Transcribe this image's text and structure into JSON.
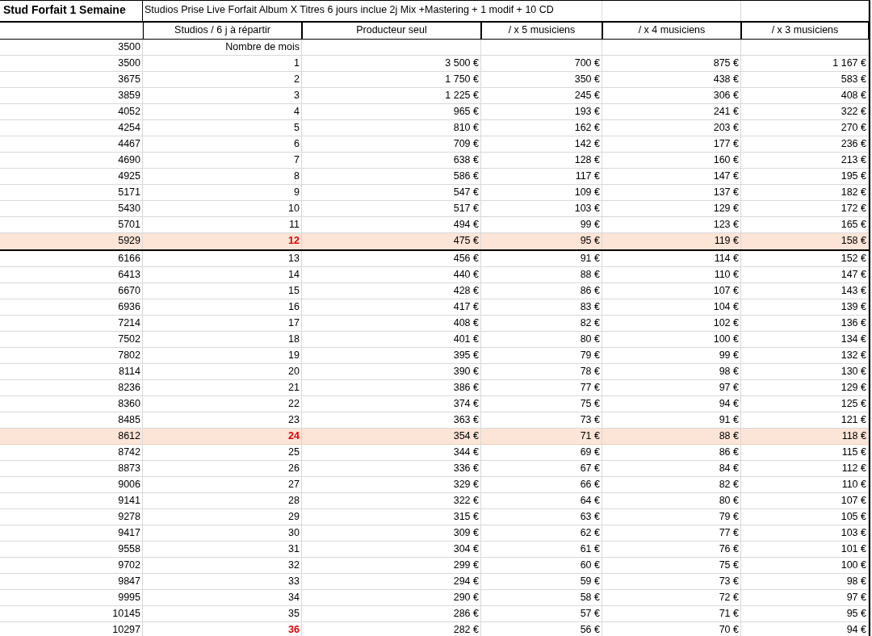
{
  "title_row": {
    "label": "Stud Forfait 1 Semaine",
    "description": "Studios Prise Live Forfait Album X Titres 6 jours inclue 2j Mix +Mastering + 1 modif + 10 CD"
  },
  "columns": [
    "Studios / 6 j à répartir",
    "Producteur seul",
    "/ x 5 musiciens",
    "/ x 4 musiciens",
    "/ x 3 musiciens"
  ],
  "rows": [
    {
      "cells": [
        "3500",
        "Nombre de mois"
      ],
      "highlighted": false,
      "emphasized": false,
      "separator_below": false
    },
    {
      "cells": [
        "3500",
        "1",
        "3 500 €",
        "700 €",
        "875 €",
        "1 167 €"
      ],
      "highlighted": false,
      "emphasized": false,
      "separator_below": false
    },
    {
      "cells": [
        "3675",
        "2",
        "1 750 €",
        "350 €",
        "438 €",
        "583 €"
      ],
      "highlighted": false,
      "emphasized": false,
      "separator_below": false
    },
    {
      "cells": [
        "3859",
        "3",
        "1 225 €",
        "245 €",
        "306 €",
        "408 €"
      ],
      "highlighted": false,
      "emphasized": false,
      "separator_below": false
    },
    {
      "cells": [
        "4052",
        "4",
        "965 €",
        "193 €",
        "241 €",
        "322 €"
      ],
      "highlighted": false,
      "emphasized": false,
      "separator_below": false
    },
    {
      "cells": [
        "4254",
        "5",
        "810 €",
        "162 €",
        "203 €",
        "270 €"
      ],
      "highlighted": false,
      "emphasized": false,
      "separator_below": false
    },
    {
      "cells": [
        "4467",
        "6",
        "709 €",
        "142 €",
        "177 €",
        "236 €"
      ],
      "highlighted": false,
      "emphasized": false,
      "separator_below": false
    },
    {
      "cells": [
        "4690",
        "7",
        "638 €",
        "128 €",
        "160 €",
        "213 €"
      ],
      "highlighted": false,
      "emphasized": false,
      "separator_below": false
    },
    {
      "cells": [
        "4925",
        "8",
        "586 €",
        "117 €",
        "147 €",
        "195 €"
      ],
      "highlighted": false,
      "emphasized": false,
      "separator_below": false
    },
    {
      "cells": [
        "5171",
        "9",
        "547 €",
        "109 €",
        "137 €",
        "182 €"
      ],
      "highlighted": false,
      "emphasized": false,
      "separator_below": false
    },
    {
      "cells": [
        "5430",
        "10",
        "517 €",
        "103 €",
        "129 €",
        "172 €"
      ],
      "highlighted": false,
      "emphasized": false,
      "separator_below": false
    },
    {
      "cells": [
        "5701",
        "11",
        "494 €",
        "99 €",
        "123 €",
        "165 €"
      ],
      "highlighted": false,
      "emphasized": false,
      "separator_below": false
    },
    {
      "cells": [
        "5929",
        "12",
        "475 €",
        "95 €",
        "119 €",
        "158 €"
      ],
      "highlighted": true,
      "emphasized": true,
      "separator_below": true
    },
    {
      "cells": [
        "6166",
        "13",
        "456 €",
        "91 €",
        "114 €",
        "152 €"
      ],
      "highlighted": false,
      "emphasized": false,
      "separator_below": false
    },
    {
      "cells": [
        "6413",
        "14",
        "440 €",
        "88 €",
        "110 €",
        "147 €"
      ],
      "highlighted": false,
      "emphasized": false,
      "separator_below": false
    },
    {
      "cells": [
        "6670",
        "15",
        "428 €",
        "86 €",
        "107 €",
        "143 €"
      ],
      "highlighted": false,
      "emphasized": false,
      "separator_below": false
    },
    {
      "cells": [
        "6936",
        "16",
        "417 €",
        "83 €",
        "104 €",
        "139 €"
      ],
      "highlighted": false,
      "emphasized": false,
      "separator_below": false
    },
    {
      "cells": [
        "7214",
        "17",
        "408 €",
        "82 €",
        "102 €",
        "136 €"
      ],
      "highlighted": false,
      "emphasized": false,
      "separator_below": false
    },
    {
      "cells": [
        "7502",
        "18",
        "401 €",
        "80 €",
        "100 €",
        "134 €"
      ],
      "highlighted": false,
      "emphasized": false,
      "separator_below": false
    },
    {
      "cells": [
        "7802",
        "19",
        "395 €",
        "79 €",
        "99 €",
        "132 €"
      ],
      "highlighted": false,
      "emphasized": false,
      "separator_below": false
    },
    {
      "cells": [
        "8114",
        "20",
        "390 €",
        "78 €",
        "98 €",
        "130 €"
      ],
      "highlighted": false,
      "emphasized": false,
      "separator_below": false
    },
    {
      "cells": [
        "8236",
        "21",
        "386 €",
        "77 €",
        "97 €",
        "129 €"
      ],
      "highlighted": false,
      "emphasized": false,
      "separator_below": false
    },
    {
      "cells": [
        "8360",
        "22",
        "374 €",
        "75 €",
        "94 €",
        "125 €"
      ],
      "highlighted": false,
      "emphasized": false,
      "separator_below": false
    },
    {
      "cells": [
        "8485",
        "23",
        "363 €",
        "73 €",
        "91 €",
        "121 €"
      ],
      "highlighted": false,
      "emphasized": false,
      "separator_below": false
    },
    {
      "cells": [
        "8612",
        "24",
        "354 €",
        "71 €",
        "88 €",
        "118 €"
      ],
      "highlighted": true,
      "emphasized": true,
      "separator_below": false
    },
    {
      "cells": [
        "8742",
        "25",
        "344 €",
        "69 €",
        "86 €",
        "115 €"
      ],
      "highlighted": false,
      "emphasized": false,
      "separator_below": false
    },
    {
      "cells": [
        "8873",
        "26",
        "336 €",
        "67 €",
        "84 €",
        "112 €"
      ],
      "highlighted": false,
      "emphasized": false,
      "separator_below": false
    },
    {
      "cells": [
        "9006",
        "27",
        "329 €",
        "66 €",
        "82 €",
        "110 €"
      ],
      "highlighted": false,
      "emphasized": false,
      "separator_below": false
    },
    {
      "cells": [
        "9141",
        "28",
        "322 €",
        "64 €",
        "80 €",
        "107 €"
      ],
      "highlighted": false,
      "emphasized": false,
      "separator_below": false
    },
    {
      "cells": [
        "9278",
        "29",
        "315 €",
        "63 €",
        "79 €",
        "105 €"
      ],
      "highlighted": false,
      "emphasized": false,
      "separator_below": false
    },
    {
      "cells": [
        "9417",
        "30",
        "309 €",
        "62 €",
        "77 €",
        "103 €"
      ],
      "highlighted": false,
      "emphasized": false,
      "separator_below": false
    },
    {
      "cells": [
        "9558",
        "31",
        "304 €",
        "61 €",
        "76 €",
        "101 €"
      ],
      "highlighted": false,
      "emphasized": false,
      "separator_below": false
    },
    {
      "cells": [
        "9702",
        "32",
        "299 €",
        "60 €",
        "75 €",
        "100 €"
      ],
      "highlighted": false,
      "emphasized": false,
      "separator_below": false
    },
    {
      "cells": [
        "9847",
        "33",
        "294 €",
        "59 €",
        "73 €",
        "98 €"
      ],
      "highlighted": false,
      "emphasized": false,
      "separator_below": false
    },
    {
      "cells": [
        "9995",
        "34",
        "290 €",
        "58 €",
        "72 €",
        "97 €"
      ],
      "highlighted": false,
      "emphasized": false,
      "separator_below": false
    },
    {
      "cells": [
        "10145",
        "35",
        "286 €",
        "57 €",
        "71 €",
        "95 €"
      ],
      "highlighted": false,
      "emphasized": false,
      "separator_below": false
    },
    {
      "cells": [
        "10297",
        "36",
        "282 €",
        "56 €",
        "70 €",
        "94 €"
      ],
      "highlighted": false,
      "emphasized": true,
      "separator_below": false
    }
  ]
}
